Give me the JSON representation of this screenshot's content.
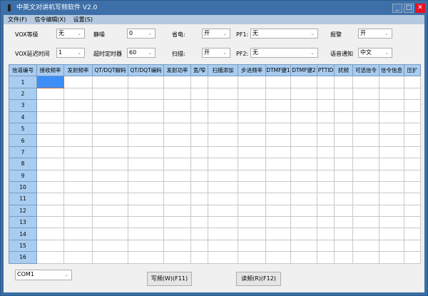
{
  "window": {
    "title": "中英文对讲机写频软件 V2.0",
    "minimize": "_",
    "maximize": "□",
    "close": "✕",
    "close_color": "#e81123"
  },
  "menu": [
    "文件(F)",
    "信令编辑(X)",
    "设置(S)"
  ],
  "settings": {
    "vox_level": {
      "label": "VOX等级",
      "value": "无"
    },
    "squelch": {
      "label": "静噪",
      "value": "0"
    },
    "power_save": {
      "label": "省电:",
      "value": "开"
    },
    "pf1": {
      "label": "PF1:",
      "value": "无"
    },
    "alarm": {
      "label": "报警",
      "value": "开"
    },
    "vox_delay": {
      "label": "VOX延迟时间",
      "value": "1"
    },
    "timeout": {
      "label": "超时定时器",
      "value": "60"
    },
    "scan": {
      "label": "扫描:",
      "value": "开"
    },
    "pf2": {
      "label": "PF2:",
      "value": "无"
    },
    "voice": {
      "label": "语音通知",
      "value": "中文"
    }
  },
  "table": {
    "columns": [
      "信道编号",
      "接收频率",
      "发射频率",
      "QT/DQT解码",
      "QT/DQT编码",
      "发射功率",
      "宽/窄",
      "扫描添加",
      "步进频率",
      "DTMF键1",
      "DTMF键2",
      "PTTID",
      "扰频",
      "可选信令",
      "信令信息",
      "压扩"
    ],
    "rows": [
      "1",
      "2",
      "3",
      "4",
      "5",
      "6",
      "7",
      "8",
      "9",
      "10",
      "11",
      "12",
      "13",
      "14",
      "15",
      "16"
    ]
  },
  "footer": {
    "port": "COM1",
    "write_button": "写频(W)(F11)",
    "read_button": "读频(R)(F12)"
  }
}
